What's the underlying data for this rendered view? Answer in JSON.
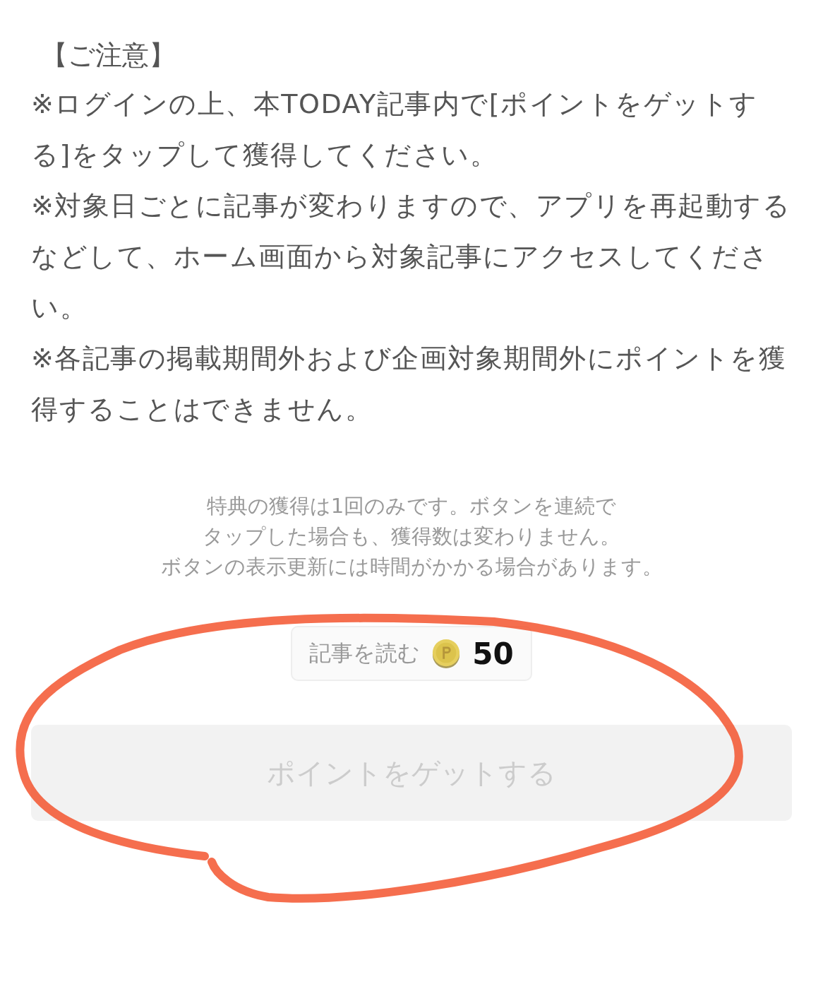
{
  "notice": {
    "heading": "【ご注意】",
    "items": [
      "※ログインの上、本TODAY記事内で[ポイントをゲットする]をタップして獲得してください。",
      "※対象日ごとに記事が変わりますので、アプリを再起動するなどして、ホーム画面から対象記事にアクセスしてください。",
      "※各記事の掲載期間外および企画対象期間外にポイントを獲得することはできません。"
    ]
  },
  "info_lines": [
    "特典の獲得は1回のみです。ボタンを連続で",
    "タップした場合も、獲得数は変わりません。",
    "ボタンの表示更新には時間がかかる場合があります。"
  ],
  "reward": {
    "label": "記事を読む",
    "points": "50"
  },
  "get_button": {
    "label": "ポイントをゲットする",
    "disabled": true
  },
  "annotation": {
    "kind": "circle"
  }
}
